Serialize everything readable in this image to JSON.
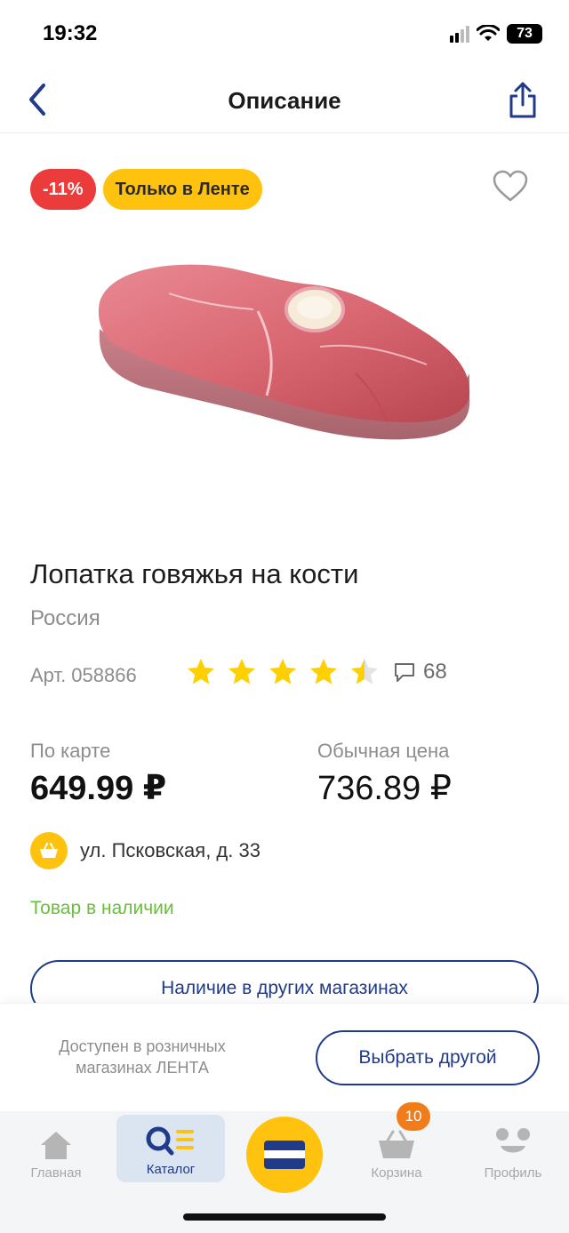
{
  "status_bar": {
    "time": "19:32",
    "battery": "73"
  },
  "header": {
    "title": "Описание",
    "back_icon": "chevron-left-icon",
    "share_icon": "share-icon"
  },
  "badges": {
    "discount": "-11%",
    "exclusive": "Только в Ленте"
  },
  "product": {
    "title": "Лопатка говяжья на кости",
    "country": "Россия",
    "article": "Арт. 058866",
    "rating": 4.5,
    "reviews_count": "68"
  },
  "prices": {
    "card_label": "По карте",
    "card_price": "649.99 ₽",
    "regular_label": "Обычная цена",
    "regular_price": "736.89 ₽"
  },
  "store": {
    "address": "ул. Псковская, д. 33"
  },
  "availability": "Товар в наличии",
  "other_stores_button": "Наличие в других магазинах",
  "sheet": {
    "note": "Доступен в розничных магазинах ЛЕНТА",
    "choose_button": "Выбрать другой"
  },
  "tabbar": {
    "home": "Главная",
    "catalog": "Каталог",
    "cart": "Корзина",
    "cart_count": "10",
    "profile": "Профиль"
  },
  "colors": {
    "brand_blue": "#1f3b8a",
    "brand_yellow": "#ffc20e",
    "discount_red": "#ec3b3b",
    "available_green": "#6abf3a",
    "cart_badge_orange": "#f07d1a"
  }
}
